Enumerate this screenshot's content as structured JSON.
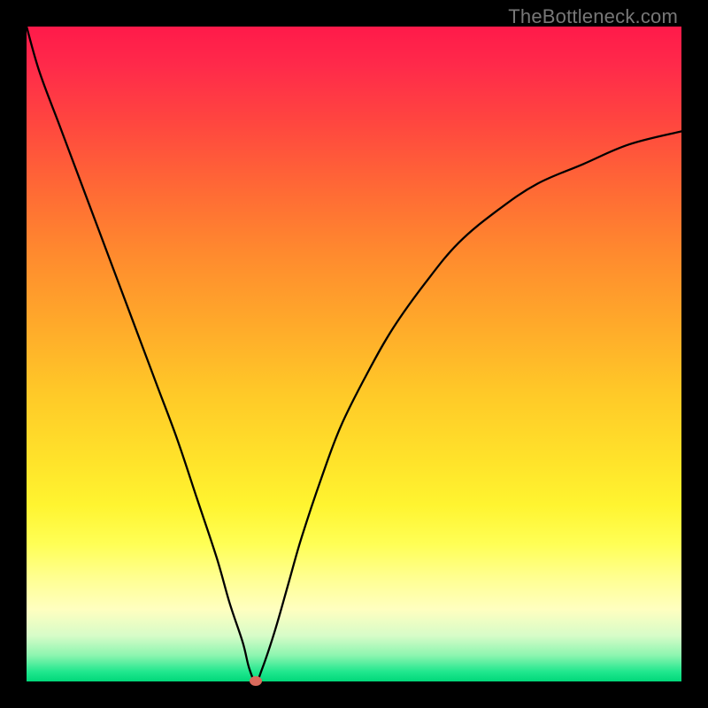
{
  "watermark": "TheBottleneck.com",
  "chart_data": {
    "type": "line",
    "title": "",
    "xlabel": "",
    "ylabel": "",
    "xlim": [
      0,
      100
    ],
    "ylim": [
      0,
      100
    ],
    "grid": false,
    "legend": false,
    "background_gradient": {
      "orientation": "vertical",
      "stops": [
        {
          "pos": 0,
          "color": "#ff1a4a"
        },
        {
          "pos": 25,
          "color": "#ff6a35"
        },
        {
          "pos": 56,
          "color": "#ffc928"
        },
        {
          "pos": 79,
          "color": "#ffff55"
        },
        {
          "pos": 93,
          "color": "#d7fcc8"
        },
        {
          "pos": 100,
          "color": "#00d87a"
        }
      ]
    },
    "series": [
      {
        "name": "bottleneck-curve",
        "x": [
          0,
          2,
          5,
          8,
          11,
          14,
          17,
          20,
          23,
          26,
          29,
          31,
          33,
          34,
          35,
          36,
          38,
          40,
          42,
          45,
          48,
          52,
          56,
          61,
          66,
          72,
          78,
          85,
          92,
          100
        ],
        "y": [
          100,
          93,
          85,
          77,
          69,
          61,
          53,
          45,
          37,
          28,
          19,
          12,
          6,
          2,
          0,
          2,
          8,
          15,
          22,
          31,
          39,
          47,
          54,
          61,
          67,
          72,
          76,
          79,
          82,
          84
        ]
      }
    ],
    "markers": [
      {
        "name": "min-point",
        "x": 35,
        "y": 0,
        "color": "#d96a5c"
      }
    ]
  }
}
